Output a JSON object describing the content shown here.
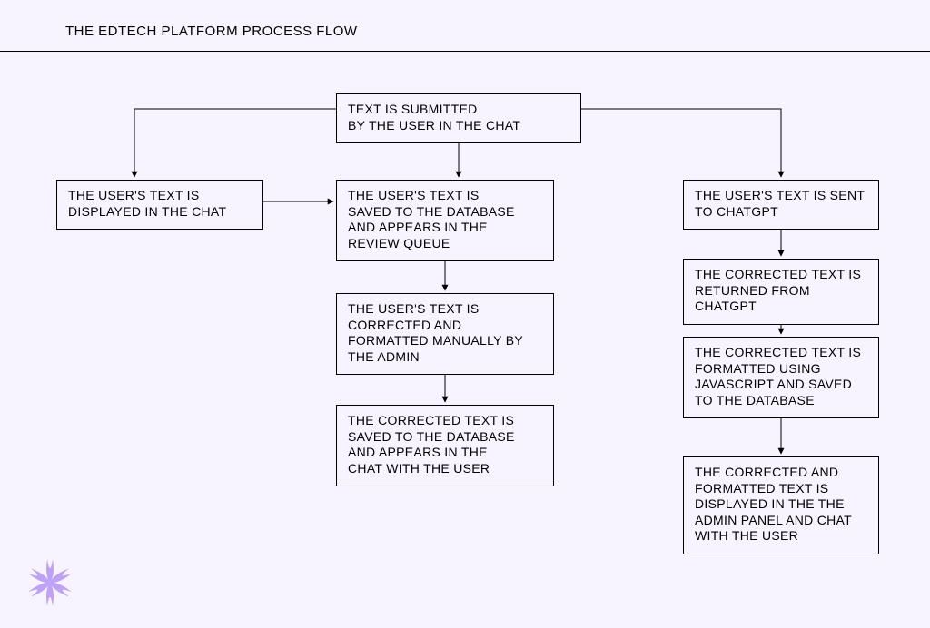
{
  "title": "THE EDTECH PLATFORM PROCESS FLOW",
  "boxes": {
    "submit": "TEXT IS SUBMITTED\nBY THE USER IN THE CHAT",
    "display": "THE USER'S TEXT IS\nDISPLAYED IN THE CHAT",
    "saveq": "THE USER'S TEXT IS\nSAVED TO THE DATABASE\nAND APPEARS IN THE\nREVIEW QUEUE",
    "manual": "THE USER'S TEXT IS\nCORRECTED AND\nFORMATTED MANUALLY BY\nTHE ADMIN",
    "msaved": "THE CORRECTED TEXT IS\nSAVED TO THE DATABASE\nAND APPEARS IN THE\nCHAT WITH THE USER",
    "sent": "THE USER'S TEXT IS SENT\nTO CHATGPT",
    "returned": "THE CORRECTED TEXT IS\nRETURNED FROM CHATGPT",
    "jsfmt": "THE CORRECTED TEXT IS\nFORMATTED USING\nJAVASCRIPT AND SAVED\nTO THE DATABASE",
    "final": "THE CORRECTED AND\nFORMATTED TEXT IS\nDISPLAYED IN THE THE\nADMIN PANEL AND CHAT\nWITH THE USER"
  }
}
